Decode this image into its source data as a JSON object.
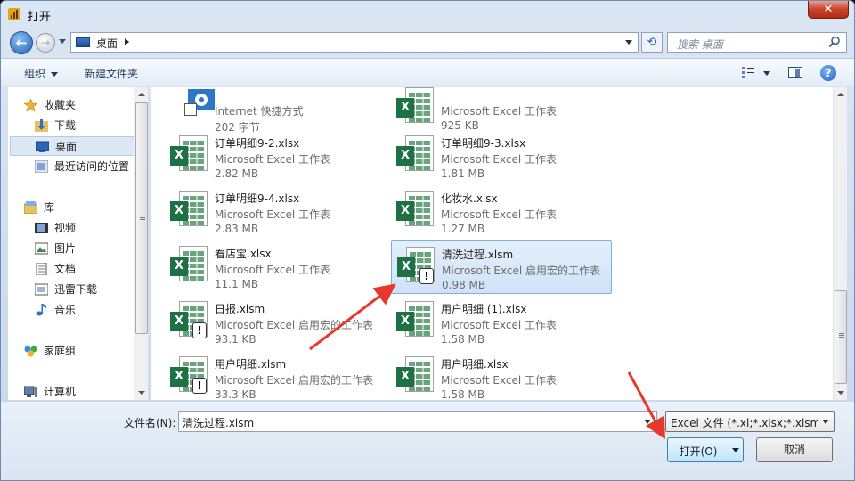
{
  "window": {
    "title": "打开",
    "close_label": "✕"
  },
  "nav": {
    "back_glyph": "←",
    "forward_glyph": "→",
    "address": "桌面",
    "refresh_glyph": "⟲",
    "search_placeholder": "搜索 桌面"
  },
  "toolbar": {
    "organize": "组织",
    "new_folder": "新建文件夹",
    "help": "?"
  },
  "sidebar": {
    "favorites": "收藏夹",
    "downloads": "下载",
    "desktop": "桌面",
    "recent": "最近访问的位置",
    "libraries": "库",
    "videos": "视频",
    "pictures": "图片",
    "documents": "文档",
    "thunder": "迅雷下载",
    "music": "音乐",
    "homegroup": "家庭组",
    "computer": "计算机"
  },
  "files": [
    {
      "name": "",
      "type": "Internet 快捷方式",
      "size": "202 字节",
      "kind": "shortcut"
    },
    {
      "name": "",
      "type": "Microsoft Excel 工作表",
      "size": "925 KB",
      "kind": "xlsx"
    },
    {
      "name": "订单明细9-2.xlsx",
      "type": "Microsoft Excel 工作表",
      "size": "2.82 MB",
      "kind": "xlsx"
    },
    {
      "name": "订单明细9-3.xlsx",
      "type": "Microsoft Excel 工作表",
      "size": "1.81 MB",
      "kind": "xlsx"
    },
    {
      "name": "订单明细9-4.xlsx",
      "type": "Microsoft Excel 工作表",
      "size": "2.83 MB",
      "kind": "xlsx"
    },
    {
      "name": "化妆水.xlsx",
      "type": "Microsoft Excel 工作表",
      "size": "1.27 MB",
      "kind": "xlsx"
    },
    {
      "name": "看店宝.xlsx",
      "type": "Microsoft Excel 工作表",
      "size": "11.1 MB",
      "kind": "xlsx"
    },
    {
      "name": "清洗过程.xlsm",
      "type": "Microsoft Excel 启用宏的工作表",
      "size": "0.98 MB",
      "kind": "xlsm",
      "selected": true
    },
    {
      "name": "日报.xlsm",
      "type": "Microsoft Excel 启用宏的工作表",
      "size": "93.1 KB",
      "kind": "xlsm"
    },
    {
      "name": "用户明细 (1).xlsx",
      "type": "Microsoft Excel 工作表",
      "size": "1.58 MB",
      "kind": "xlsx"
    },
    {
      "name": "用户明细.xlsm",
      "type": "Microsoft Excel 启用宏的工作表",
      "size": "33.3 KB",
      "kind": "xlsm"
    },
    {
      "name": "用户明细.xlsx",
      "type": "Microsoft Excel 工作表",
      "size": "1.58 MB",
      "kind": "xlsx"
    }
  ],
  "footer": {
    "filename_label": "文件名(N):",
    "filename_value": "清洗过程.xlsm",
    "filter": "Excel 文件 (*.xl;*.xlsx;*.xlsm;*.xlsb;*.xlam;*.xltx;*.xltm;*.xls;*.xla;*.xlt;*.xlm;*.xlw)",
    "open": "打开(O)",
    "cancel": "取消"
  },
  "colors": {
    "accent": "#1e7145",
    "selection": "#cfe2f8",
    "annotation": "#e8372c"
  }
}
